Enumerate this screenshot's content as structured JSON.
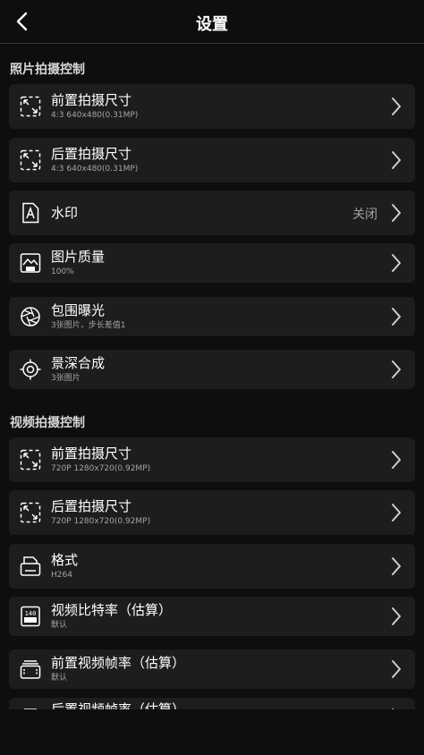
{
  "header": {
    "title": "设置"
  },
  "photo_section": {
    "title": "照片拍摄控制",
    "items": [
      {
        "label": "前置拍摄尺寸",
        "sub": "4:3 640x480(0.31MP)"
      },
      {
        "label": "后置拍摄尺寸",
        "sub": "4:3 640x480(0.31MP)"
      },
      {
        "label": "水印",
        "value": "关闭"
      },
      {
        "label": "图片质量",
        "sub": "100%"
      },
      {
        "label": "包围曝光",
        "sub": "3张图片，步长差值1"
      },
      {
        "label": "景深合成",
        "sub": "3张图片"
      }
    ]
  },
  "video_section": {
    "title": "视频拍摄控制",
    "items": [
      {
        "label": "前置拍摄尺寸",
        "sub": "720P 1280x720(0.92MP)"
      },
      {
        "label": "后置拍摄尺寸",
        "sub": "720P 1280x720(0.92MP)"
      },
      {
        "label": "格式",
        "sub": "H264"
      },
      {
        "label": "视频比特率（估算）",
        "sub": "默认"
      },
      {
        "label": "前置视频帧率（估算）",
        "sub": "默认"
      },
      {
        "label": "后置视频帧率（估算）"
      }
    ]
  },
  "icons": {
    "back": "chevron-left-icon",
    "chevron": "chevron-right-icon",
    "front_size": "expand-arrows-icon",
    "back_size": "expand-arrows-icon",
    "watermark": "watermark-document-icon",
    "quality": "hd-image-icon",
    "bracketing": "aperture-icon",
    "focus_stacking": "crosshair-target-icon",
    "format": "printer-icon",
    "bitrate": "bpm-counter-icon",
    "framerate": "film-stack-icon",
    "bitrate_badge": "140"
  }
}
